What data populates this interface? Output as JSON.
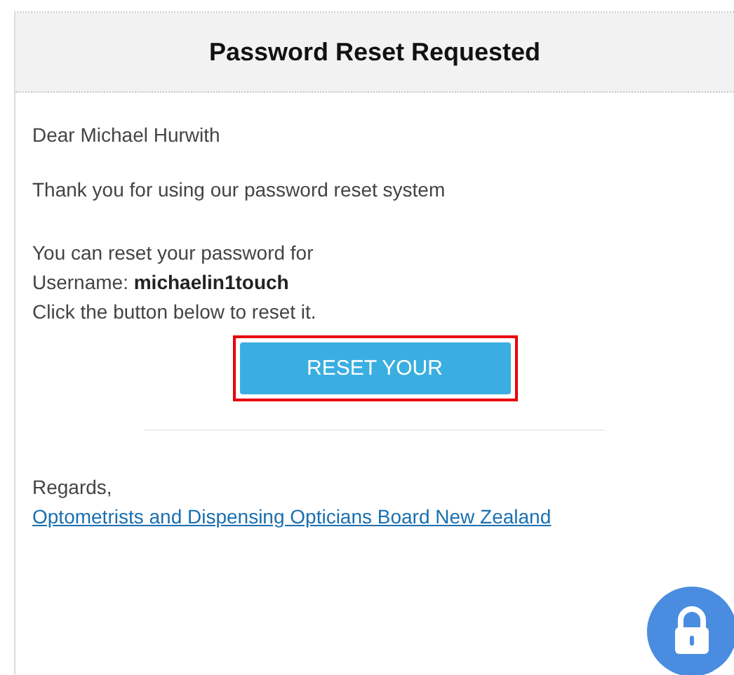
{
  "email": {
    "title": "Password Reset Requested",
    "greeting": "Dear Michael Hurwith",
    "intro": "Thank you for using our password reset system",
    "lines": [
      "You can reset your password for",
      "Username: **michaelin1touch**",
      "Click the button below to reset it."
    ],
    "button": {
      "label": "RESET YOUR",
      "highlighted": true
    },
    "closing": "Regards,",
    "signature_link": "Optometrists and Dispensing Opticians Board New Zealand"
  }
}
